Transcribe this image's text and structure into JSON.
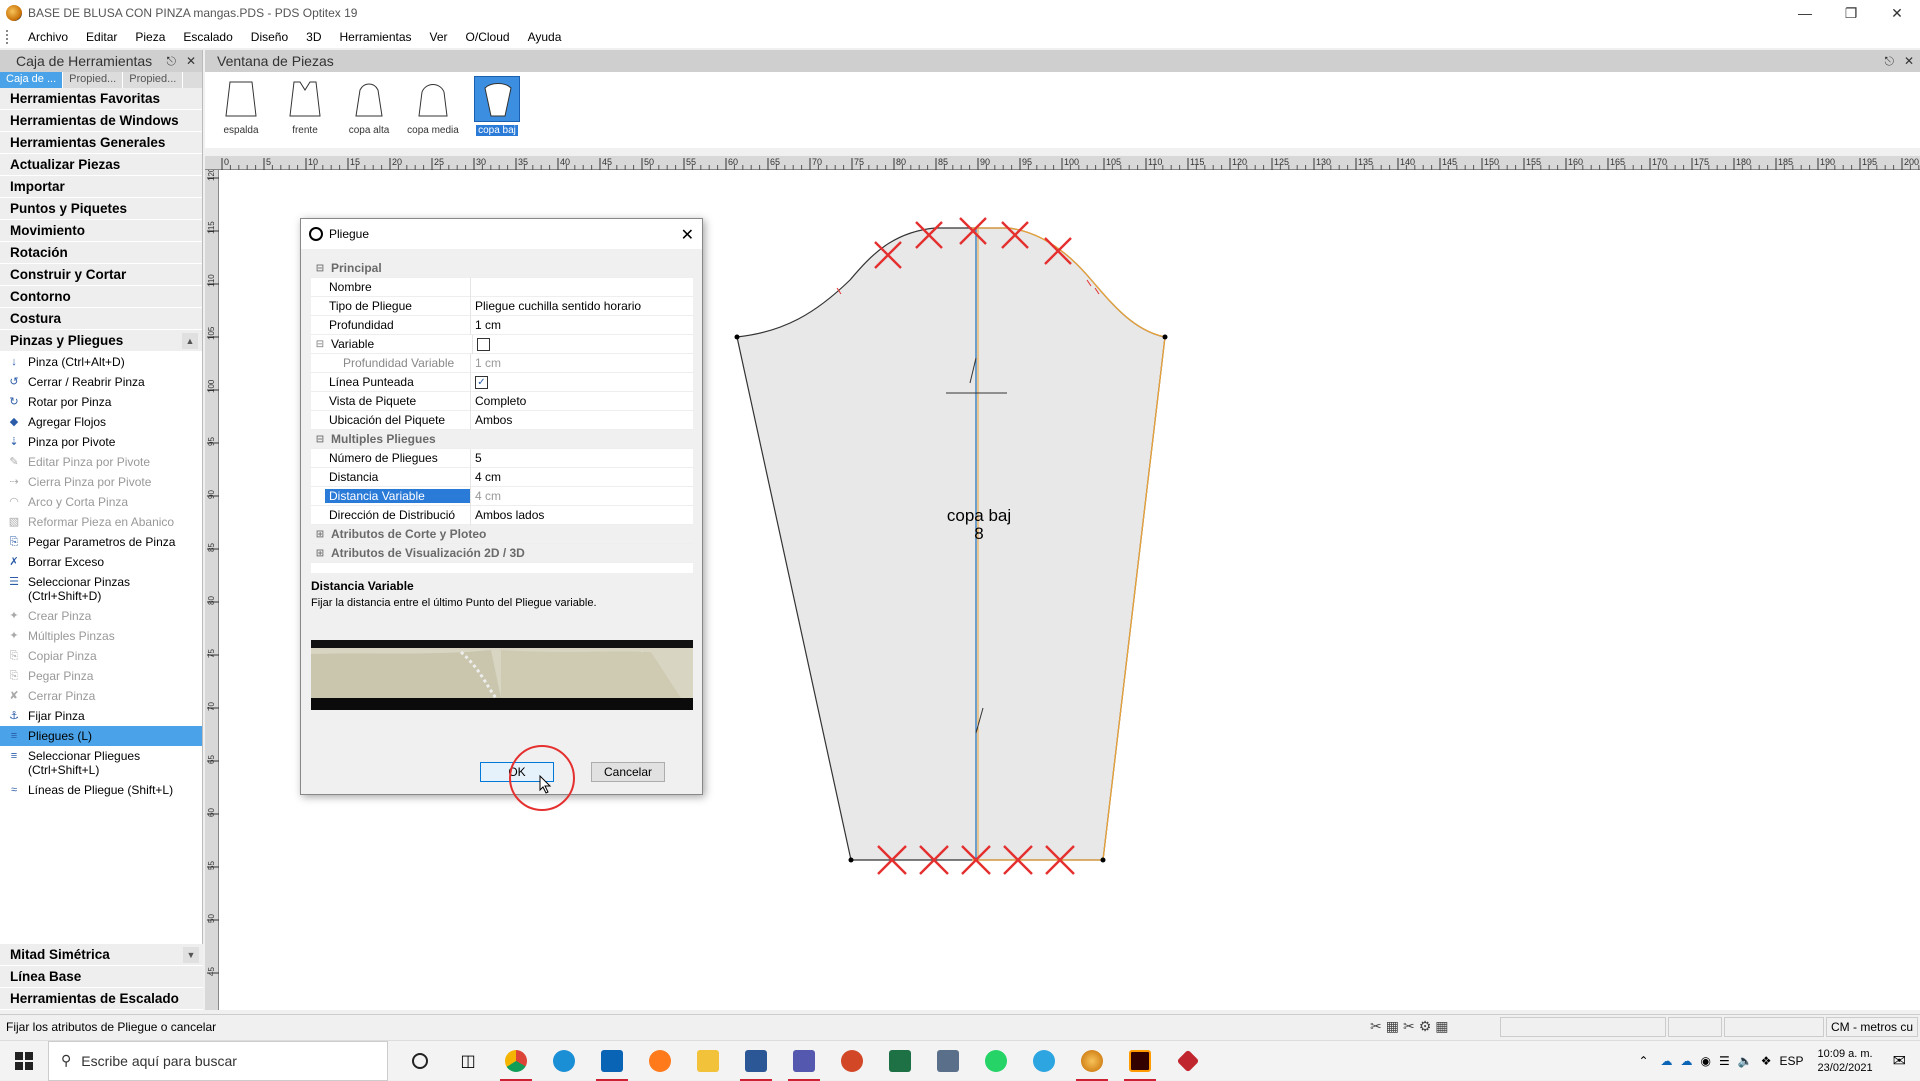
{
  "window": {
    "title": "BASE DE BLUSA CON PINZA mangas.PDS - PDS Optitex 19"
  },
  "menu": [
    "Archivo",
    "Editar",
    "Pieza",
    "Escalado",
    "Diseño",
    "3D",
    "Herramientas",
    "Ver",
    "O/Cloud",
    "Ayuda"
  ],
  "toolbox": {
    "title": "Caja de Herramientas",
    "tabs": [
      "Caja de ...",
      "Propied...",
      "Propied..."
    ],
    "categories": [
      "Herramientas Favoritas",
      "Herramientas de Windows",
      "Herramientas Generales",
      "Actualizar Piezas",
      "Importar",
      "Puntos y Piquetes",
      "Movimiento",
      "Rotación",
      "Construir y Cortar",
      "Contorno",
      "Costura",
      "Pinzas y Pliegues"
    ],
    "tools": [
      {
        "label": "Pinza (Ctrl+Alt+D)",
        "state": "enabled"
      },
      {
        "label": "Cerrar / Reabrir Pinza",
        "state": "enabled"
      },
      {
        "label": "Rotar por Pinza",
        "state": "enabled"
      },
      {
        "label": "Agregar Flojos",
        "state": "enabled"
      },
      {
        "label": "Pinza por Pivote",
        "state": "enabled"
      },
      {
        "label": "Editar Pinza por Pivote",
        "state": "disabled"
      },
      {
        "label": "Cierra Pinza por Pivote",
        "state": "disabled"
      },
      {
        "label": "Arco y Corta Pinza",
        "state": "disabled"
      },
      {
        "label": "Reformar Pieza en Abanico",
        "state": "disabled"
      },
      {
        "label": "Pegar Parametros de Pinza",
        "state": "enabled"
      },
      {
        "label": "Borrar Exceso",
        "state": "enabled"
      },
      {
        "label": "Seleccionar Pinzas\n(Ctrl+Shift+D)",
        "state": "enabled"
      },
      {
        "label": "Crear Pinza",
        "state": "disabled"
      },
      {
        "label": "Múltiples Pinzas",
        "state": "disabled"
      },
      {
        "label": "Copiar Pinza",
        "state": "disabled"
      },
      {
        "label": "Pegar Pinza",
        "state": "disabled"
      },
      {
        "label": "Cerrar Pinza",
        "state": "disabled"
      },
      {
        "label": "Fijar Pinza",
        "state": "enabled"
      },
      {
        "label": "Pliegues (L)",
        "state": "selected"
      },
      {
        "label": "Seleccionar Pliegues\n(Ctrl+Shift+L)",
        "state": "enabled"
      },
      {
        "label": "Líneas de Pliegue (Shift+L)",
        "state": "enabled"
      }
    ],
    "bottom_categories": [
      "Mitad Simétrica",
      "Línea Base",
      "Herramientas de Escalado"
    ]
  },
  "pieces_window": {
    "title": "Ventana de Piezas",
    "pieces": [
      {
        "label": "espalda",
        "selected": false
      },
      {
        "label": "frente",
        "selected": false
      },
      {
        "label": "copa alta",
        "selected": false
      },
      {
        "label": "copa media",
        "selected": false
      },
      {
        "label": "copa baj",
        "selected": true
      }
    ]
  },
  "ruler": {
    "top_labels": [
      "0",
      "5",
      "10",
      "15",
      "20",
      "25",
      "30",
      "35",
      "40",
      "45",
      "50",
      "55",
      "60",
      "65",
      "70",
      "75",
      "80",
      "85",
      "90",
      "95",
      "100",
      "105",
      "110",
      "115",
      "120",
      "125",
      "130",
      "135",
      "140",
      "145",
      "150",
      "155",
      "160",
      "165",
      "170",
      "175",
      "180",
      "185",
      "190",
      "195",
      "200"
    ],
    "left_labels": [
      "120",
      "115",
      "110",
      "105",
      "100",
      "95",
      "90",
      "85",
      "80",
      "75",
      "70",
      "65",
      "60",
      "55",
      "50",
      "45"
    ]
  },
  "canvas": {
    "piece_name": "copa baj",
    "piece_number": "8"
  },
  "dialog": {
    "title": "Pliegue",
    "sections": {
      "principal": "Principal",
      "multiples": "Multiples Pliegues",
      "corte": "Atributos de Corte y Ploteo",
      "visual": "Atributos de Visualización 2D / 3D"
    },
    "props": {
      "nombre": {
        "name": "Nombre",
        "value": ""
      },
      "tipo": {
        "name": "Tipo de Pliegue",
        "value": "Pliegue cuchilla sentido horario"
      },
      "profundidad": {
        "name": "Profundidad",
        "value": "1 cm"
      },
      "variable": {
        "name": "Variable",
        "checked": false
      },
      "prof_variable": {
        "name": "Profundidad Variable",
        "value": "1 cm"
      },
      "linea": {
        "name": "Línea Punteada",
        "checked": true
      },
      "vista": {
        "name": "Vista de Piquete",
        "value": "Completo"
      },
      "ubicacion": {
        "name": "Ubicación del Piquete",
        "value": "Ambos"
      },
      "numero": {
        "name": "Número de Pliegues",
        "value": "5"
      },
      "distancia": {
        "name": "Distancia",
        "value": "4 cm"
      },
      "dist_variable": {
        "name": "Distancia Variable",
        "value": "4 cm"
      },
      "direccion": {
        "name": "Dirección de Distribució",
        "value": "Ambos lados"
      }
    },
    "description_title": "Distancia Variable",
    "description_text": "Fijar la distancia entre el último Punto del Pliegue variable.",
    "ok_label": "OK",
    "cancel_label": "Cancelar"
  },
  "status": {
    "message": "Fijar los atributos de Pliegue o cancelar",
    "units": "CM - metros cu"
  },
  "taskbar": {
    "search_placeholder": "Escribe aquí para buscar",
    "language": "ESP",
    "time": "10:09 a. m.",
    "date": "23/02/2021"
  },
  "colors": {
    "accent": "#4aa3e8",
    "selection": "#2a7ad8",
    "mark_red": "#e53030",
    "seam_orange": "#e8a23a",
    "piece_fill": "#e8e8e8"
  }
}
